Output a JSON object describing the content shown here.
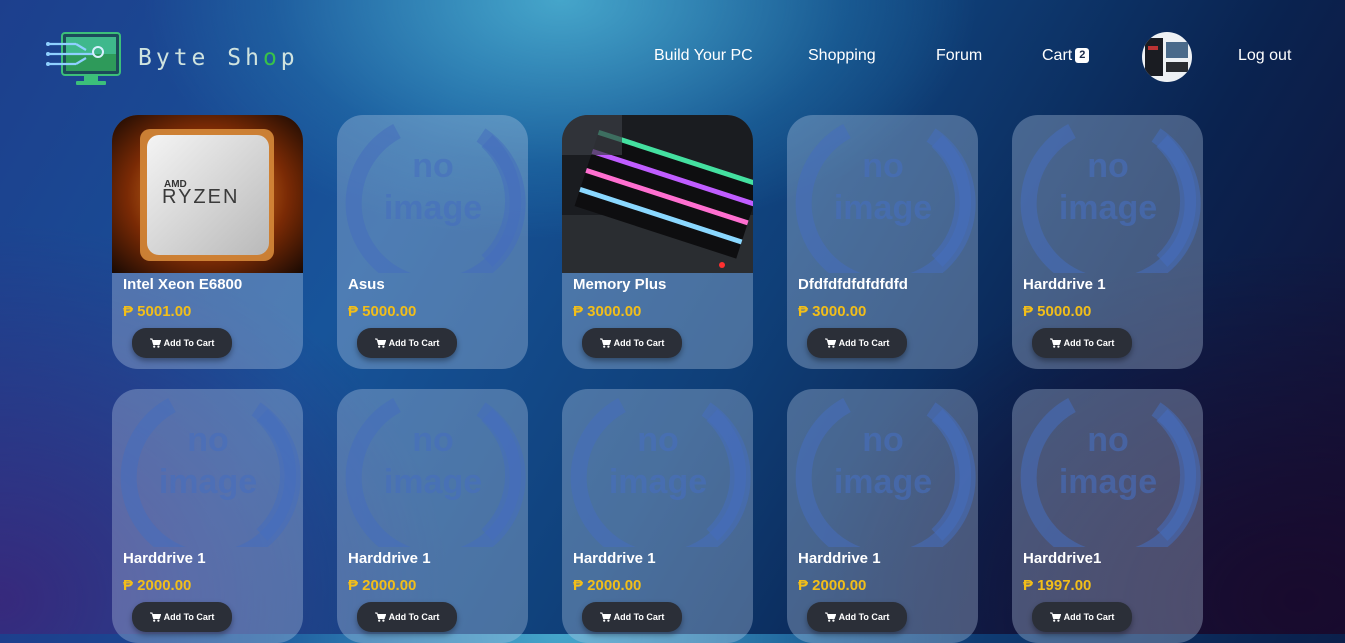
{
  "brand": {
    "name_prefix": "Byte Sh",
    "name_o": "o",
    "name_suffix": "p",
    "logo_icon": "circuit-monitor-logo"
  },
  "nav": {
    "build": "Build Your PC",
    "shopping": "Shopping",
    "forum": "Forum",
    "cart": "Cart",
    "cart_count": "2",
    "logout": "Log out"
  },
  "no_image_text": [
    "no",
    "image"
  ],
  "add_to_cart_label": "Add To Cart",
  "colors": {
    "price": "#f2be19",
    "button": "#2b2f38",
    "accent_logo": "#39c24a"
  },
  "products": [
    {
      "name": "Intel Xeon E6800",
      "price": "₱ 5001.00",
      "image": "amd-ryzen-cpu"
    },
    {
      "name": "Asus",
      "price": "₱ 5000.00",
      "image": "no-image"
    },
    {
      "name": "Memory Plus",
      "price": "₱ 3000.00",
      "image": "rgb-ram-modules"
    },
    {
      "name": "Dfdfdfdfdfdfdfd",
      "price": "₱ 3000.00",
      "image": "no-image"
    },
    {
      "name": "Harddrive 1",
      "price": "₱ 5000.00",
      "image": "no-image"
    },
    {
      "name": "Harddrive 1",
      "price": "₱ 2000.00",
      "image": "no-image"
    },
    {
      "name": "Harddrive 1",
      "price": "₱ 2000.00",
      "image": "no-image"
    },
    {
      "name": "Harddrive 1",
      "price": "₱ 2000.00",
      "image": "no-image"
    },
    {
      "name": "Harddrive 1",
      "price": "₱ 2000.00",
      "image": "no-image"
    },
    {
      "name": "Harddrive1",
      "price": "₱ 1997.00",
      "image": "no-image"
    }
  ]
}
